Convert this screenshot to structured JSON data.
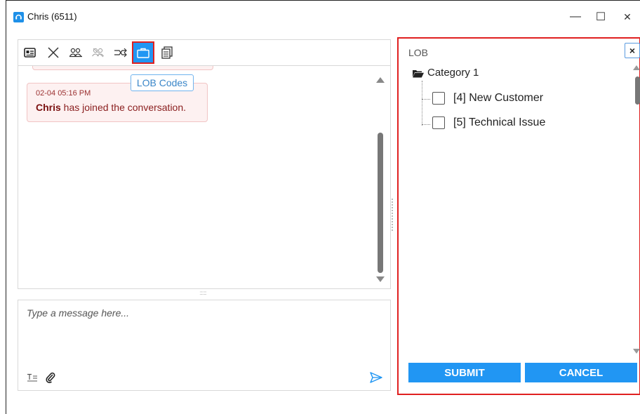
{
  "window": {
    "title": "Chris (6511)",
    "minimize": "—",
    "maximize": "☐",
    "close": "✕"
  },
  "toolbar": {
    "items": [
      {
        "icon": "contact-card-icon",
        "state": "normal"
      },
      {
        "icon": "close-x-icon",
        "state": "normal"
      },
      {
        "icon": "conference-icon",
        "state": "normal"
      },
      {
        "icon": "conference-disabled-icon",
        "state": "disabled"
      },
      {
        "icon": "transfer-icon",
        "state": "normal"
      },
      {
        "icon": "briefcase-icon",
        "state": "active"
      },
      {
        "icon": "document-icon",
        "state": "normal"
      }
    ],
    "tooltip": "LOB Codes"
  },
  "chat": {
    "messages": [
      {
        "time": "02-04 05:16 PM",
        "sender": "Chris",
        "text": " has joined the conversation."
      }
    ]
  },
  "compose": {
    "placeholder": "Type a message here..."
  },
  "lob": {
    "title": "LOB",
    "close": "×",
    "category": "Category 1",
    "items": [
      {
        "label": "[4] New Customer",
        "checked": false
      },
      {
        "label": "[5] Technical Issue",
        "checked": false
      }
    ],
    "submit": "SUBMIT",
    "cancel": "CANCEL"
  },
  "colors": {
    "accent": "#2196f3",
    "highlight_border": "#e02020",
    "system_bubble_bg": "#fdf1f1",
    "system_bubble_text": "#8b2020"
  }
}
